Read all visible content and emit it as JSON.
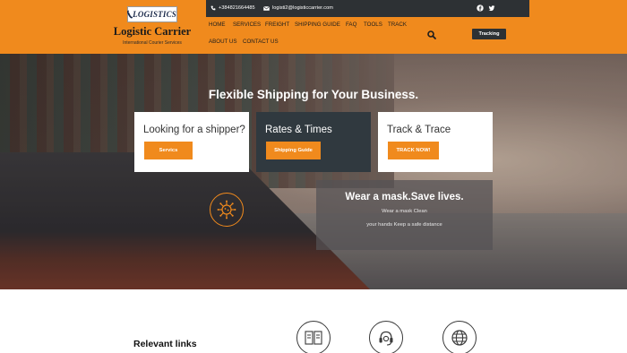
{
  "brand": {
    "logo_text": "LOGISTICS",
    "name": "Logistic Carrier",
    "tagline": "International Courier Services"
  },
  "topbar": {
    "phone": "+384821664485",
    "email": "logisti2@logisticcarrier.com",
    "social": [
      "facebook-icon",
      "twitter-icon"
    ]
  },
  "nav": {
    "items": [
      "HOME",
      "SERVICES",
      "FREIGHT",
      "SHIPPING GUIDE",
      "FAQ",
      "TOOLS",
      "TRACK",
      "ABOUT US",
      "CONTACT US"
    ],
    "tracking_label": "Tracking"
  },
  "hero": {
    "title": "Flexible Shipping for Your Business.",
    "cards": [
      {
        "title": "Looking for a shipper?",
        "button": "Servics"
      },
      {
        "title": "Rates & Times",
        "button": "Shipping Guide"
      },
      {
        "title": "Track & Trace",
        "button": "TRACK NOW!"
      }
    ],
    "mask": {
      "title": "Wear a mask.Save lives.",
      "line1": "Wear a mask Clean",
      "line2": "your hands Keep a safe distance"
    }
  },
  "section": {
    "relevant_title": "Relevant links",
    "icons": [
      "document-icon",
      "support-headset-icon",
      "globe-icon"
    ]
  },
  "colors": {
    "accent": "#f08a1d",
    "dark": "#2d3134",
    "card_dark": "#30393f"
  }
}
